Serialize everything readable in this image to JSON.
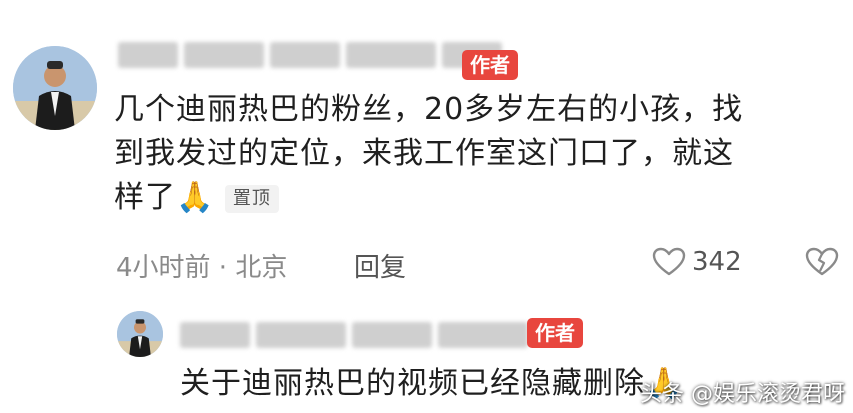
{
  "comment": {
    "author_badge": "作者",
    "text_line1": "几个迪丽热巴的粉丝，20多岁左右的小孩，找",
    "text_line2": "到我发过的定位，来我工作室这门口了，就这",
    "text_line3": "样了",
    "emoji": "🙏",
    "pinned_label": "置顶",
    "time": "4小时前 · 北京",
    "reply_label": "回复",
    "like_count": "342"
  },
  "reply": {
    "author_badge": "作者",
    "text": "关于迪丽热巴的视频已经隐藏删除",
    "emoji": "🙏"
  },
  "watermark": "头条 @娱乐滚烫君呀",
  "colors": {
    "badge": "#e8463e",
    "meta": "#8a8a8a"
  },
  "icons": [
    "heart-outline-icon",
    "broken-heart-icon",
    "praying-hands-emoji"
  ]
}
